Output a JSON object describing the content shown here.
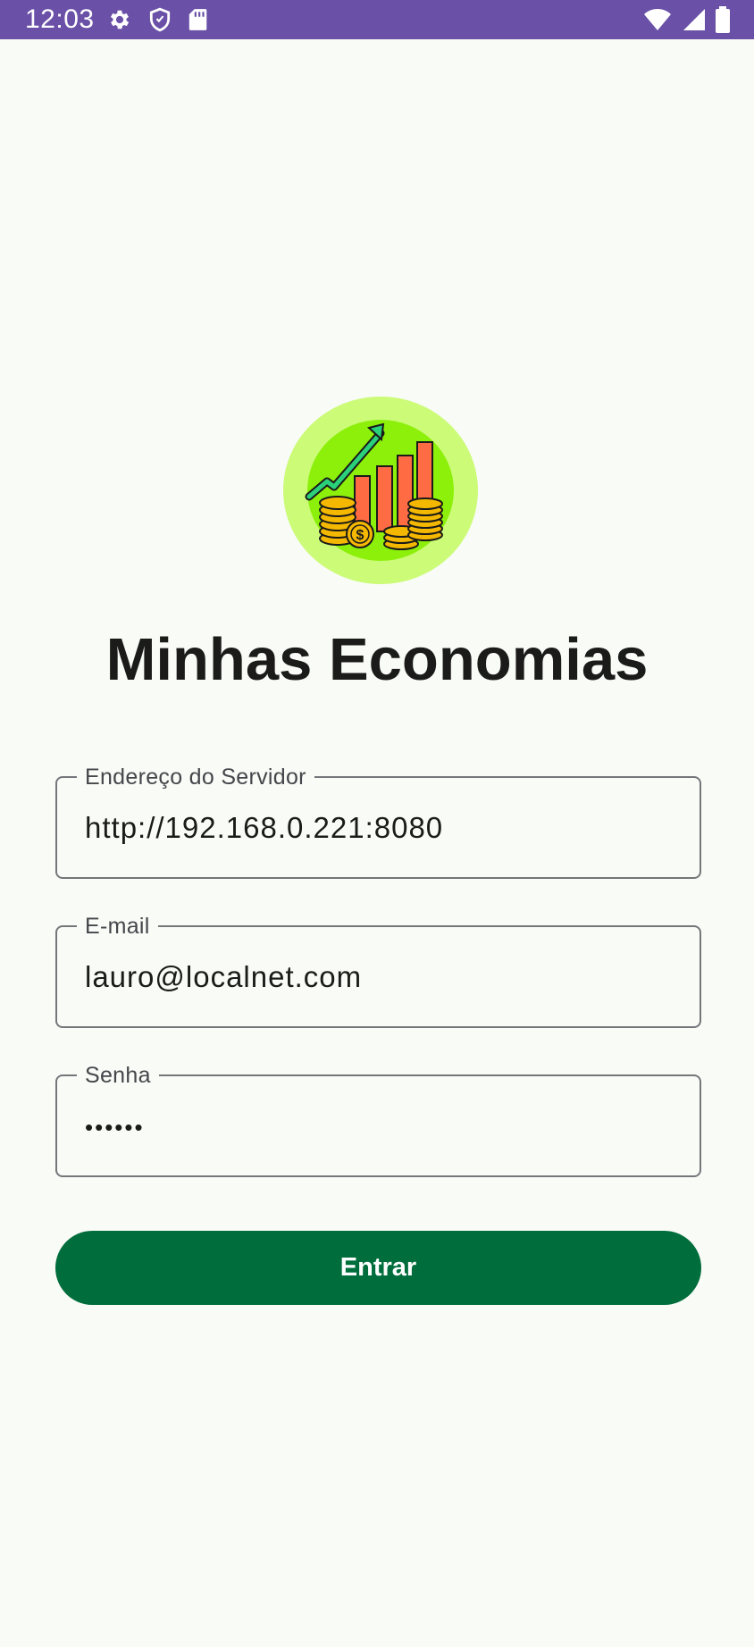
{
  "status_bar": {
    "time": "12:03",
    "left_icons": [
      "gear-icon",
      "shield-icon",
      "sd-card-icon"
    ],
    "right_icons": [
      "wifi-icon",
      "signal-icon",
      "battery-icon"
    ]
  },
  "app": {
    "title": "Minhas Economias",
    "logo_icon": "savings-chart-logo"
  },
  "form": {
    "server": {
      "label": "Endereço do Servidor",
      "value": "http://192.168.0.221:8080"
    },
    "email": {
      "label": "E-mail",
      "value": "lauro@localnet.com"
    },
    "password": {
      "label": "Senha",
      "masked_value": "••••••"
    },
    "submit_label": "Entrar"
  },
  "colors": {
    "status_bar": "#6a50a7",
    "background": "#f9fbf7",
    "primary_button": "#006d3c",
    "outline": "#74777a",
    "logo_outer": "#ccfb78",
    "logo_inner": "#8cf00a",
    "bars": "#ff6b43",
    "coins": "#f5b800",
    "arrow": "#2bd07a"
  }
}
